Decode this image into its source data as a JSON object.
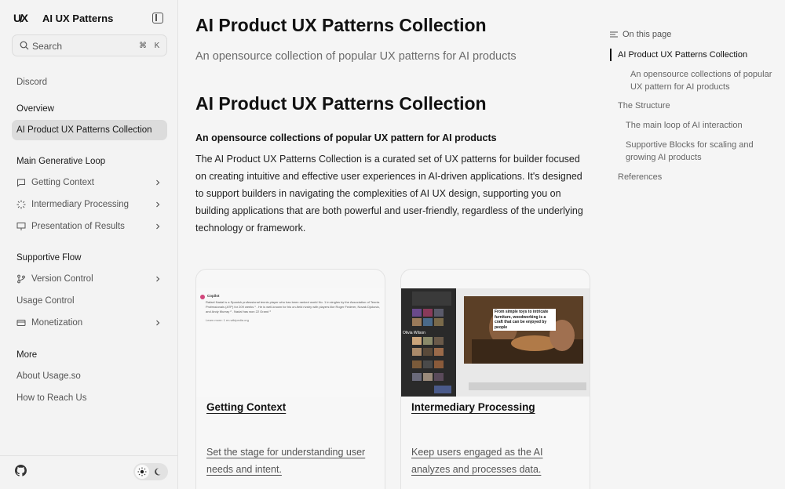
{
  "sidebar": {
    "logo": "U̸X",
    "app_title": "AI UX Patterns",
    "search": {
      "placeholder": "Search",
      "kbd_cmd": "⌘",
      "kbd_key": "K"
    },
    "discord": "Discord",
    "overview_heading": "Overview",
    "overview_item": "AI Product UX Patterns Collection",
    "main_loop_heading": "Main Generative Loop",
    "main_loop_items": [
      "Getting Context",
      "Intermediary Processing",
      "Presentation of Results"
    ],
    "supportive_heading": "Supportive Flow",
    "supportive_items": [
      "Version Control",
      "Usage Control",
      "Monetization"
    ],
    "more_heading": "More",
    "more_items": [
      "About Usage.so",
      "How to Reach Us"
    ]
  },
  "main": {
    "page_title": "AI Product UX Patterns Collection",
    "page_subtitle": "An opensource collection of popular UX patterns for AI products",
    "heading": "AI Product UX Patterns Collection",
    "subheading": "An opensource collections of popular UX pattern for AI products",
    "paragraph": "The AI Product UX Patterns Collection is a curated set of UX patterns for builder focused on creating intuitive and effective user experiences in AI-driven applications. It's designed to support builders in navigating the complexities of AI UX design, supporting you on building applications that are both powerful and user-friendly, regardless of the underlying technology or framework.",
    "cards": [
      {
        "title": "Getting Context",
        "description": "Set the stage for understanding user needs and intent.",
        "preview": {
          "app_name": "Copilot",
          "text": "Rafael Nadal is a Spanish professional tennis player who has been ranked world No. 1 in singles by the Association of Tennis Professionals (ATP) for 209 weeks ¹ . He is well-known for his on-field rivalry with players like Roger Federer, Novak Djokovic, and Andy Murray ² . Nadal has won 22 Grand ³",
          "learn_more": "Learn more: 1 en.wikipedia.org"
        }
      },
      {
        "title": "Intermediary Processing",
        "description": "Keep users engaged as the AI analyzes and processes data.",
        "preview": {
          "caption": "From simple toys to intricate furniture, woodworking is a craft that can be enjoyed by people",
          "presenter": "Olivia Wilson"
        }
      }
    ]
  },
  "toc": {
    "heading": "On this page",
    "items": [
      "AI Product UX Patterns Collection",
      "An opensource collections of popular UX pattern for AI products",
      "The Structure",
      "The main loop of AI interaction",
      "Supportive Blocks for scaling and growing AI products",
      "References"
    ]
  },
  "colors": {
    "active_bg": "#dcdcdc",
    "text": "#111111",
    "muted": "#666666"
  }
}
